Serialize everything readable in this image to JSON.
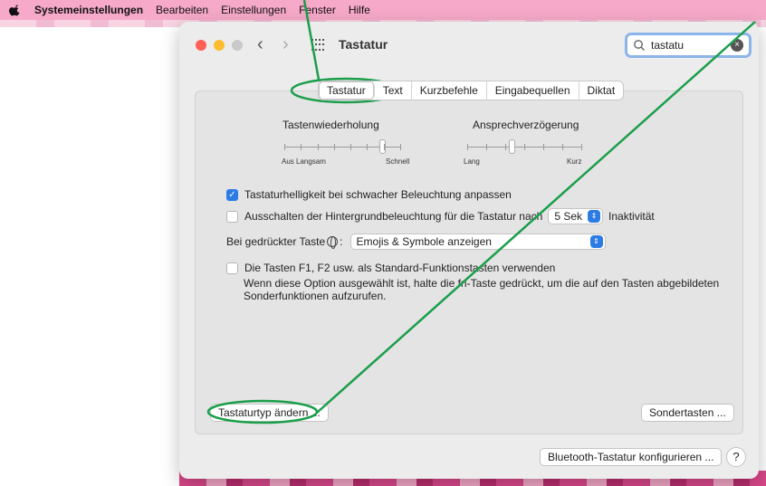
{
  "menubar": {
    "app": "Systemeinstellungen",
    "items": [
      "Bearbeiten",
      "Einstellungen",
      "Fenster",
      "Hilfe"
    ]
  },
  "window": {
    "title": "Tastatur"
  },
  "search": {
    "value": "tastatu"
  },
  "tabs": [
    "Tastatur",
    "Text",
    "Kurzbefehle",
    "Eingabequellen",
    "Diktat"
  ],
  "repeat_slider": {
    "title": "Tastenwiederholung",
    "left_labels": "Aus  Langsam",
    "right_label": "Schnell",
    "value": 0.85
  },
  "delay_slider": {
    "title": "Ansprechverzögerung",
    "left_label": "Lang",
    "right_label": "Kurz",
    "value": 0.4
  },
  "options": {
    "brightness": "Tastaturhelligkeit bei schwacher Beleuchtung anpassen",
    "backlight_prefix": "Ausschalten der Hintergrundbeleuchtung für die Tastatur nach",
    "backlight_value": "5 Sek",
    "backlight_suffix": "Inaktivität",
    "fn_key_prefix": "Bei gedrückter Taste",
    "fn_key_value": "Emojis & Symbole anzeigen",
    "fkeys": "Die Tasten F1, F2 usw. als Standard-Funktionstasten verwenden",
    "fkeys_desc_1": "Wenn diese Option ausgewählt ist, halte die fn-Taste gedrückt, um die auf den Tasten abgebildeten",
    "fkeys_desc_2": "Sonderfunktionen aufzurufen."
  },
  "buttons": {
    "change_type": "Tastaturtyp ändern ...",
    "modifier_keys": "Sondertasten ...",
    "bluetooth": "Bluetooth-Tastatur konfigurieren ...",
    "help": "?"
  },
  "colors": {
    "menubar": "#f6a9c8",
    "accent": "#2d7be5",
    "annotation": "#1a9e4a"
  }
}
